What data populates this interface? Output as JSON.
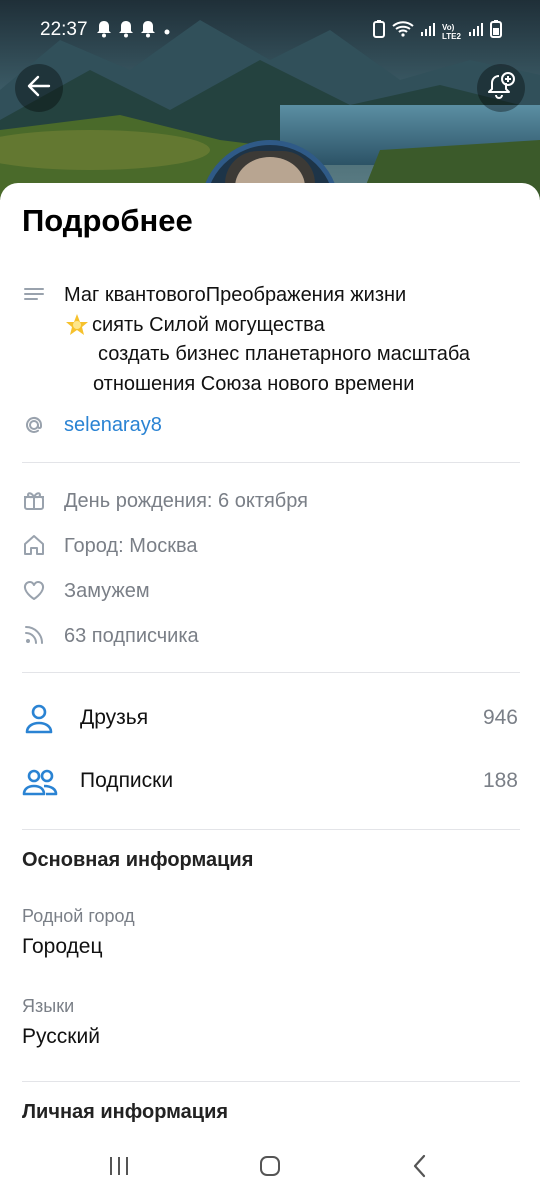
{
  "status_bar": {
    "time": "22:37",
    "network_label": "Vo) LTE2"
  },
  "header": {
    "back_icon": "arrow-left-icon",
    "notify_icon": "bell-plus-icon"
  },
  "sheet": {
    "title": "Подробнее",
    "about": {
      "line1": "Маг квантовогоПреображения жизни",
      "line2": "сиять Силой могущества",
      "line3": "создать бизнес планетарного масштаба",
      "line4": "отношения Союза нового времени"
    },
    "username": "selenaray8",
    "birthday": "День рождения: 6 октября",
    "city": "Город: Москва",
    "relationship": "Замужем",
    "followers": "63 подписчика",
    "friends": {
      "label": "Друзья",
      "count": "946"
    },
    "subscriptions": {
      "label": "Подписки",
      "count": "188"
    },
    "main_info": {
      "title": "Основная информация",
      "hometown_label": "Родной город",
      "hometown_value": "Городец",
      "languages_label": "Языки",
      "languages_value": "Русский"
    },
    "personal_info": {
      "title": "Личная информация"
    }
  },
  "colors": {
    "accent": "#2a83d3",
    "secondary_text": "#7a7f87",
    "divider": "#e3e4e8"
  }
}
